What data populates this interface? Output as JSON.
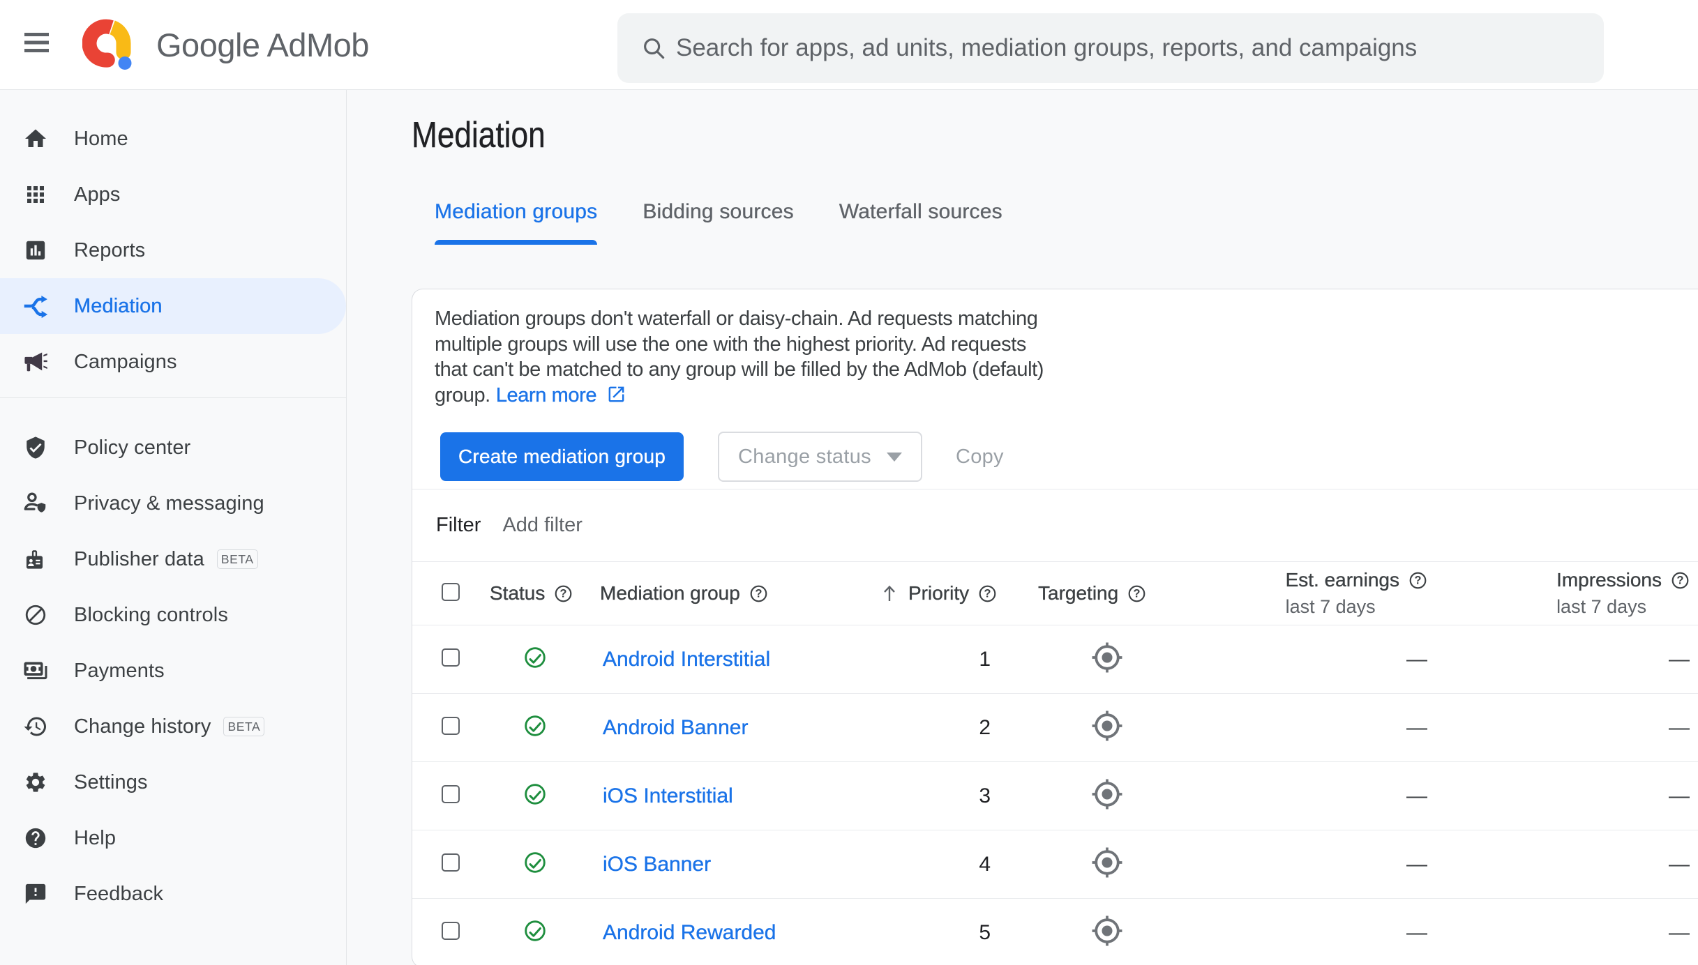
{
  "topbar": {
    "brand": "Google AdMob",
    "search_placeholder": "Search for apps, ad units, mediation groups, reports, and campaigns"
  },
  "sidebar": {
    "primary": [
      {
        "label": "Home"
      },
      {
        "label": "Apps"
      },
      {
        "label": "Reports"
      },
      {
        "label": "Mediation",
        "selected": true
      },
      {
        "label": "Campaigns"
      }
    ],
    "secondary": [
      {
        "label": "Policy center"
      },
      {
        "label": "Privacy & messaging"
      },
      {
        "label": "Publisher data",
        "badge": "BETA"
      },
      {
        "label": "Blocking controls"
      },
      {
        "label": "Payments"
      },
      {
        "label": "Change history",
        "badge": "BETA"
      },
      {
        "label": "Settings"
      },
      {
        "label": "Help"
      },
      {
        "label": "Feedback"
      }
    ]
  },
  "page": {
    "title": "Mediation",
    "tabs": [
      {
        "label": "Mediation groups",
        "active": true
      },
      {
        "label": "Bidding sources",
        "active": false
      },
      {
        "label": "Waterfall sources",
        "active": false
      }
    ],
    "notice": {
      "line1": "Mediation groups don't waterfall or daisy-chain. Ad requests matching",
      "line2": "multiple groups will use the one with the highest priority. Ad requests",
      "line3": "that can't be matched to any group will be filled by the AdMob (default)",
      "line4": "group.",
      "link_label": "Learn more"
    },
    "actions": {
      "create": "Create mediation group",
      "change_status": "Change status",
      "copy": "Copy"
    },
    "filter": {
      "label": "Filter",
      "add_label": "Add filter"
    },
    "table": {
      "columns": {
        "status": "Status",
        "group": "Mediation group",
        "priority": "Priority",
        "targeting": "Targeting",
        "earnings": "Est. earnings",
        "impressions": "Impressions",
        "period": "last 7 days"
      },
      "rows": [
        {
          "name": "Android Interstitial",
          "priority": "1",
          "earnings": "—",
          "impressions": "—"
        },
        {
          "name": "Android Banner",
          "priority": "2",
          "earnings": "—",
          "impressions": "—"
        },
        {
          "name": "iOS Interstitial",
          "priority": "3",
          "earnings": "—",
          "impressions": "—"
        },
        {
          "name": "iOS Banner",
          "priority": "4",
          "earnings": "—",
          "impressions": "—"
        },
        {
          "name": "Android Rewarded",
          "priority": "5",
          "earnings": "—",
          "impressions": "—"
        }
      ]
    }
  },
  "icons": {
    "help_glyph": "?"
  },
  "colors": {
    "accent_blue": "#1a73e8",
    "selected_pill": "#e8f0fe",
    "status_green": "#1e8e3e",
    "logo_red": "#e94335",
    "logo_yellow": "#f9ba16",
    "logo_blue": "#4285f4"
  }
}
